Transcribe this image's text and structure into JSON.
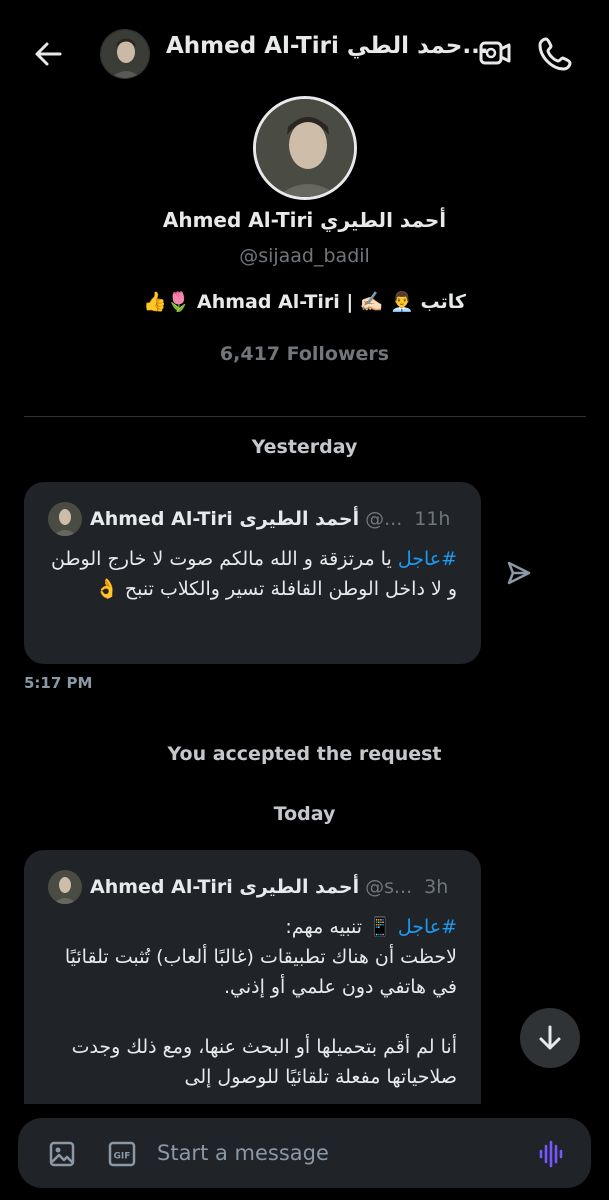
{
  "header": {
    "title": "Ahmed Al-Tiri حمد الطي...",
    "back_icon": "arrow-left-icon",
    "video_icon": "video-call-icon",
    "phone_icon": "phone-icon"
  },
  "profile": {
    "name": "Ahmed Al-Tiri أحمد الطيري",
    "handle": "@sijaad_badil",
    "bio": "👍🌷  Ahmad  Al-Tiri | ✍🏻 👨‍💼 كاتب",
    "followers": "6,417 Followers"
  },
  "days": {
    "yesterday": "Yesterday",
    "today": "Today"
  },
  "messages": [
    {
      "name": "Ahmed Al-Tiri أحمد الطيرى",
      "handle": "@...",
      "time": "11h",
      "hashtag": "#عاجل",
      "text": " يا مرتزقة و الله مالكم صوت لا خارج الوطن و لا داخل الوطن القافلة تسير والكلاب تنبح 👌"
    },
    {
      "name": "Ahmed Al-Tiri أحمد الطيرى",
      "handle": "@s...",
      "time": "3h",
      "hashtag": "#عاجل",
      "text": " 📱 تنبيه مهم:\nلاحظت أن هناك تطبيقات (غالبًا ألعاب) تُثبت تلقائيًا في هاتفي دون علمي أو إذني.\n\nأنا لم أقم بتحميلها أو البحث عنها، ومع ذلك وجدت صلاحياتها مفعلة تلقائيًا للوصول إلى"
    }
  ],
  "message_timestamp": "5:17 PM",
  "system_message": "You accepted the request",
  "composer": {
    "placeholder": "Start a message",
    "image_icon": "image-icon",
    "gif_label": "GIF",
    "voice_icon": "voice-wave-icon"
  },
  "colors": {
    "background": "#000000",
    "card": "#202327",
    "accent": "#1d9bf0",
    "voice": "#7856ff"
  }
}
